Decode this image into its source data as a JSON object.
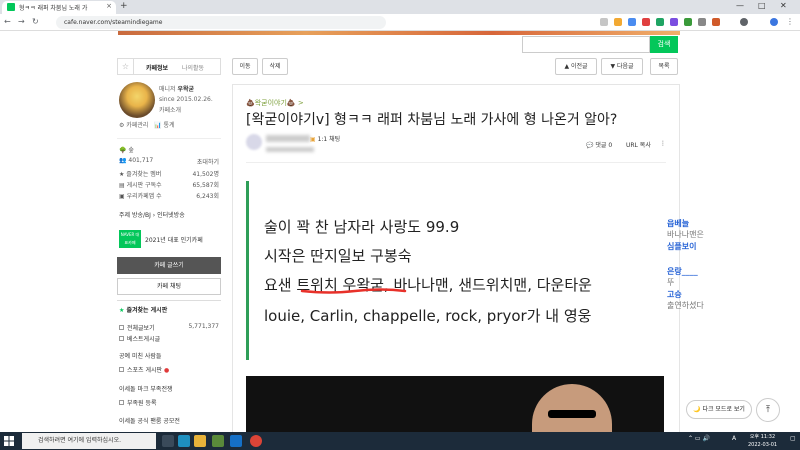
{
  "browser": {
    "tab_title": "형ㅋㅋ 래퍼 차붐님 노래 가",
    "tab_close": "×",
    "new_tab": "+",
    "url": "cafe.naver.com/steamindiegame",
    "win_min": "—",
    "win_max": "□",
    "win_close": "✕"
  },
  "search": {
    "placeholder": "",
    "button": "검색"
  },
  "sidebar": {
    "tab_info": "카페정보",
    "tab_activity": "나의활동",
    "manager_label": "매니저",
    "manager_name": "우왁굳",
    "since": "since 2015.02.26.",
    "intro": "카페소개",
    "cafe_mgmt": "카페관리",
    "stats_link": "통계",
    "grade": "숲",
    "members": "401,717",
    "invite": "초대하기",
    "stat_rows": [
      {
        "label": "즐겨찾는 멤버",
        "value": "41,502명"
      },
      {
        "label": "게시판 구독수",
        "value": "65,587회"
      },
      {
        "label": "우리카페앱 수",
        "value": "6,243회"
      }
    ],
    "topic": "주제 방송/BJ › 인터넷방송",
    "award_badge": "NAVER 대표카페",
    "award": "2021년 대표 인기카페",
    "write_btn": "카페 글쓰기",
    "chat_btn": "카페 채팅",
    "fav_header": "즐겨찾는 게시판",
    "menu": [
      {
        "label": "전체글보기",
        "value": "5,771,377"
      },
      {
        "label": "베스트게시글",
        "value": ""
      },
      {
        "label": "공예 미친 사람들",
        "value": ""
      },
      {
        "label": "스포츠 게시판",
        "value": ""
      },
      {
        "label": "이세돌 마크 부족전쟁",
        "value": ""
      },
      {
        "label": "부족원 등록",
        "value": ""
      },
      {
        "label": "이세돌 공식 팬룸 공모전",
        "value": ""
      }
    ]
  },
  "toolbar": {
    "move": "이동",
    "delete": "삭제",
    "prev": "▲ 이전글",
    "next": "▼ 다음글",
    "list": "목록"
  },
  "article": {
    "category": "💩왁굳이야기💩 >",
    "title": "[왁굳이야기v] 형ㅋㅋ 래퍼 차붐님 노래 가사에 형 나온거 알아?",
    "rank": "1:1 채팅",
    "comments": "댓글 0",
    "url_copy": "URL 복사",
    "more": "⋮",
    "lines": [
      "술이 꽉 찬 남자라 사랑도 99.9",
      "시작은 딴지일보 구봉숙",
      "요샌 트위치 우왁굳, 바나나맨, 샌드위치맨, 다운타운",
      "louie, Carlin, chappelle, rock, pryor가 내 영웅"
    ]
  },
  "side_comments": [
    {
      "user": "읍베늘",
      "text": "바나나맨은"
    },
    {
      "user": "심플보이",
      "text": ""
    },
    {
      "user": "은랑____",
      "text": "뚜"
    },
    {
      "user": "고승",
      "text": "출연하셨다"
    }
  ],
  "dark_mode": "🌙 다크 모드로 보기",
  "to_top": "⤒",
  "taskbar": {
    "search": "검색하려면 여기에 입력하십시오.",
    "lang": "A",
    "time": "오후 11:32",
    "date": "2022-03-01"
  }
}
